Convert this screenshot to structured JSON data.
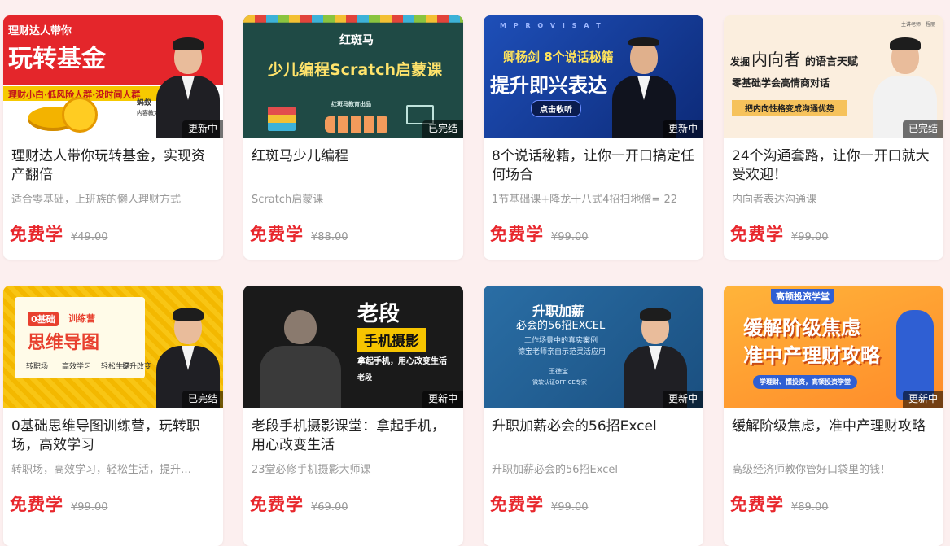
{
  "courses": [
    {
      "thumb": {
        "banner": "理财达人带你",
        "headline": "玩转基金",
        "strip": "理财小白·低风险人群·没时间人群",
        "side_name": "蚂蚁",
        "side_text": "内容教大家"
      },
      "badge": "更新中",
      "title": "理财达人带你玩转基金，实现资产翻倍",
      "subtitle": "适合零基础，上班族的懒人理财方式",
      "free": "免费学",
      "price": "¥49.00"
    },
    {
      "thumb": {
        "logo": "红斑马",
        "headline": "少儿编程Scratch启蒙课",
        "caption": "红斑马教育出品"
      },
      "badge": "已完结",
      "title": "红斑马少儿编程",
      "subtitle": "Scratch启蒙课",
      "free": "免费学",
      "price": "¥88.00"
    },
    {
      "thumb": {
        "top": "M P R O V I S A T",
        "line1": "卿杨剑 8个说话秘籍",
        "headline": "提升即兴表达",
        "button": "点击收听"
      },
      "badge": "更新中",
      "title": "8个说话秘籍，让你一开口搞定任何场合",
      "subtitle": "1节基础课+降龙十八式4招扫地僧= 22",
      "free": "免费学",
      "price": "¥99.00"
    },
    {
      "thumb": {
        "pre": "发掘",
        "big": "内向者",
        "post": "的语言天赋",
        "line2": "零基础学会高情商对话",
        "strip": "把内向性格变成沟通优势",
        "corner": "主讲老师：程丽"
      },
      "badge": "已完结",
      "title": "24个沟通套路，让你一开口就大受欢迎！",
      "subtitle": "内向者表达沟通课",
      "free": "免费学",
      "price": "¥99.00"
    },
    {
      "thumb": {
        "tag1": "0基础",
        "tag2": "训练营",
        "headline": "思维导图",
        "items": [
          "转职场",
          "高效学习",
          "轻松生活",
          "提升改变"
        ]
      },
      "badge": "已完结",
      "title": "0基础思维导图训练营，玩转职场，高效学习",
      "subtitle": "转职场，高效学习，轻松生活，提升…",
      "free": "免费学",
      "price": "¥99.00"
    },
    {
      "thumb": {
        "line1": "老段",
        "line2": "手机摄影",
        "line3": "拿起手机，用心改变生活",
        "name": "老段"
      },
      "badge": "更新中",
      "title": "老段手机摄影课堂：拿起手机，用心改变生活",
      "subtitle": "23堂必修手机摄影大师课",
      "free": "免费学",
      "price": "¥69.00"
    },
    {
      "thumb": {
        "line1": "升职加薪",
        "line2": "必会的56招EXCEL",
        "line3": "工作场景中的真实案例",
        "line4": "德宝老师亲自示范灵活应用",
        "name": "王德宝",
        "role": "微软认证OFFICE专家"
      },
      "badge": "更新中",
      "title": "升职加薪必会的56招Excel",
      "subtitle": "升职加薪必会的56招Excel",
      "free": "免费学",
      "price": "¥99.00"
    },
    {
      "thumb": {
        "top": "高顿投资学堂",
        "line1": "缓解阶级焦虑",
        "line2": "准中产理财攻略",
        "pill": "学理财、懂投资，高顿投资学堂"
      },
      "badge": "更新中",
      "title": "缓解阶级焦虑，准中产理财攻略",
      "subtitle": "高级经济师教你管好口袋里的钱！",
      "free": "免费学",
      "price": "¥89.00"
    }
  ]
}
